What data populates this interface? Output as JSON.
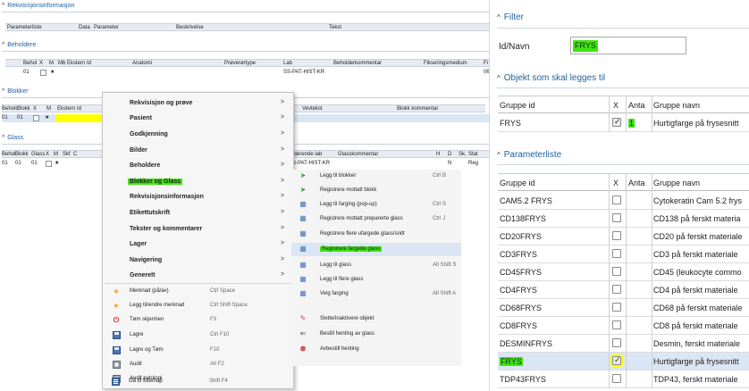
{
  "left": {
    "rekv": {
      "title": "Rekvisisjonsinformasjon",
      "cols": [
        "Parameterliste",
        "Data",
        "Parameter",
        "Beskrivelse",
        "Tekst"
      ]
    },
    "beholdere": {
      "title": "Beholdere",
      "cols": [
        "Behol",
        "X",
        "M",
        "Mb",
        "Ekstern Id",
        "Anatomi",
        "Prøverørtype",
        "Lab",
        "Beholderkommentar",
        "Fikseringsmedium",
        "Fi"
      ],
      "row": {
        "id": "01",
        "lab": "SS-PAT-HIST-KR",
        "fi": "06"
      }
    },
    "blokker": {
      "title": "Blokker",
      "cols": [
        "Beholc",
        "Blokk",
        "X",
        "M",
        "Ekstern Id",
        "Vevtekst",
        "Blokk kommentar"
      ],
      "row": {
        "behol": "01",
        "blokk": "01"
      }
    },
    "glass": {
      "title": "Glass",
      "cols": [
        "Behol",
        "Blokk",
        "Glass",
        "X",
        "M",
        "Skf",
        "C",
        "værende lab",
        "Glasskommentar",
        "H",
        "D",
        "Sk.",
        "Stat"
      ],
      "row": {
        "behol": "01",
        "blokk": "01",
        "glass": "01",
        "lab": "S-PAT-HIST-KR",
        "d": "N",
        "stat": "Reg"
      }
    }
  },
  "menu": {
    "items": [
      {
        "label": "Rekvisisjon og prøve",
        "arrow": ">"
      },
      {
        "label": "Pasient",
        "arrow": ">"
      },
      {
        "label": "Godkjenning",
        "arrow": ">"
      },
      {
        "label": "Bilder",
        "arrow": ">"
      },
      {
        "label": "Beholdere",
        "arrow": ">"
      },
      {
        "label": "Blokker og Glass",
        "arrow": ">"
      },
      {
        "label": "Rekvisisjonsinformasjon",
        "arrow": ">"
      },
      {
        "label": "Etikettutskrift",
        "arrow": ">"
      },
      {
        "label": "Tekster og kommentarer",
        "arrow": ">"
      },
      {
        "label": "Lager",
        "arrow": ">"
      },
      {
        "label": "Navigering",
        "arrow": ">"
      },
      {
        "label": "Generelt",
        "arrow": ">"
      }
    ],
    "actions": [
      {
        "label": "Merknad (på/av)",
        "shortcut": "Ctrl Space",
        "icon": "star-icon"
      },
      {
        "label": "Legg til/endre merknad",
        "shortcut": "Ctrl Shift Space",
        "icon": "star-icon"
      },
      {
        "label": "Tøm skjermen",
        "shortcut": "F3",
        "icon": "power-icon"
      },
      {
        "label": "Lagre",
        "shortcut": "Ctrl F10",
        "icon": "save-icon"
      },
      {
        "label": "Lagre og Tøm",
        "shortcut": "F10",
        "icon": "save-icon"
      },
      {
        "label": "Audit",
        "shortcut": "Alt F2",
        "icon": "audit-icon"
      },
      {
        "label": "Audit patologi",
        "shortcut": "",
        "icon": "audit-icon"
      },
      {
        "label": "Gå til Sitemap",
        "shortcut": "Shift F4",
        "icon": "sitemap-icon"
      }
    ]
  },
  "submenu": {
    "items": [
      {
        "label": "Legg til blokker",
        "shortcut": "Ctrl B",
        "icon": "arrow-icon"
      },
      {
        "label": "Registrere mottatt blokk",
        "shortcut": "",
        "icon": "arrow-icon"
      },
      {
        "label": "Legg til farging (pop-up)",
        "shortcut": "Ctrl S",
        "icon": "grid-icon"
      },
      {
        "label": "Registrere mottatt preparerte glass",
        "shortcut": "Ctrl J",
        "icon": "grid-icon"
      },
      {
        "label": "Registrere flere ufargede glass/snitt",
        "shortcut": "",
        "icon": "grid-icon"
      },
      {
        "label": "Registrere fargede glass",
        "shortcut": "",
        "icon": "grid-icon"
      },
      {
        "label": "Legg til glass",
        "shortcut": "Alt Shift S",
        "icon": "grid-icon"
      },
      {
        "label": "Legg til flere glass",
        "shortcut": "",
        "icon": "grid-icon"
      },
      {
        "label": "Velg farging",
        "shortcut": "Alt Shift A",
        "icon": "grid-icon"
      },
      {
        "label": "Slette/inaktivere objekt",
        "shortcut": "",
        "icon": "delete-icon"
      },
      {
        "label": "Bestill henting av glass",
        "shortcut": "",
        "icon": "back-arrow-icon"
      },
      {
        "label": "Avbestill henting",
        "shortcut": "",
        "icon": "cancel-icon"
      }
    ]
  },
  "right": {
    "filter": {
      "title": "Filter",
      "label": "Id/Navn",
      "value": "FRYS"
    },
    "objekt": {
      "title": "Objekt som skal legges til",
      "cols": [
        "Gruppe id",
        "X",
        "Anta",
        "Gruppe navn"
      ],
      "row": {
        "id": "FRYS",
        "anta": "1",
        "navn": "Hurtigfarge på frysesnitt"
      }
    },
    "param": {
      "title": "Parameterliste",
      "cols": [
        "Gruppe id",
        "X",
        "Anta",
        "Gruppe navn"
      ],
      "rows": [
        {
          "id": "CAM5.2 FRYS",
          "navn": "Cytokeratin Cam 5.2 frys",
          "checked": false
        },
        {
          "id": "CD138FRYS",
          "navn": "CD138 på ferskt materia",
          "checked": false
        },
        {
          "id": "CD20FRYS",
          "navn": "CD20 på ferskt materiale",
          "checked": false
        },
        {
          "id": "CD3FRYS",
          "navn": "CD3 på ferskt materiale",
          "checked": false
        },
        {
          "id": "CD45FRYS",
          "navn": "CD45 (leukocyte commo",
          "checked": false
        },
        {
          "id": "CD4FRYS",
          "navn": "CD4 på ferskt materiale",
          "checked": false
        },
        {
          "id": "CD68FRYS",
          "navn": "CD68 på ferskt materiale",
          "checked": false
        },
        {
          "id": "CD8FRYS",
          "navn": "CD8 på ferskt materiale",
          "checked": false
        },
        {
          "id": "DESMINFRYS",
          "navn": "Desmin, ferskt materiale",
          "checked": false
        },
        {
          "id": "FRYS",
          "navn": "Hurtigfarge på frysesnitt",
          "checked": true
        },
        {
          "id": "TDP43FRYS",
          "navn": "TDP43, ferskt materiale",
          "checked": false
        }
      ]
    }
  },
  "colors": {
    "highlight": "#3ee60f",
    "selected_row": "#dbe6f4",
    "accent": "#1f5f9e",
    "yellow": "#ffff00"
  }
}
